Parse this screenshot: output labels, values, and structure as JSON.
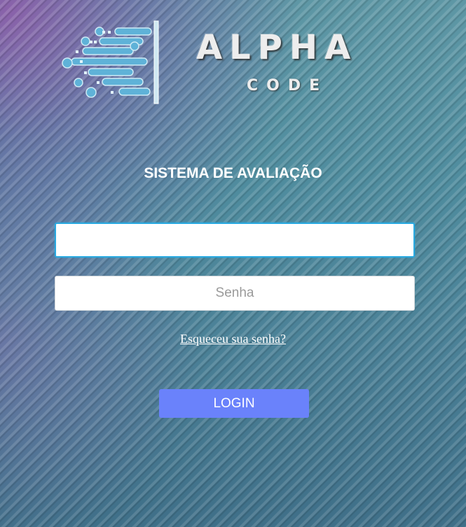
{
  "logo": {
    "word": "ALPHA",
    "sub": "CODE"
  },
  "title": "SISTEMA DE AVALIAÇÃO",
  "form": {
    "username_value": "",
    "username_placeholder": "",
    "password_placeholder": "Senha",
    "forgot_label": "Esqueceu sua senha?",
    "login_label": "LOGIN"
  },
  "colors": {
    "accent": "#6a82fb",
    "focus_border": "#29a9e0",
    "background": "#4a7e92"
  }
}
